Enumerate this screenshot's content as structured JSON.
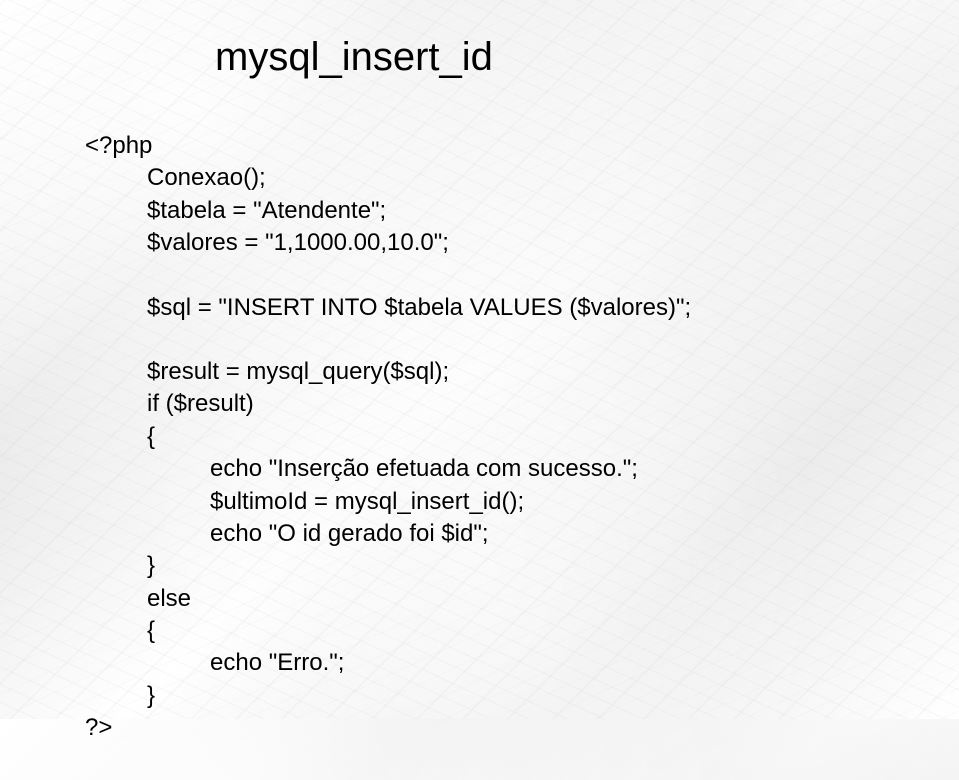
{
  "slide": {
    "title": "mysql_insert_id",
    "code": {
      "line1": "<?php",
      "line2": "Conexao();",
      "line3": "$tabela = \"Atendente\";",
      "line4": "$valores = \"1,1000.00,10.0\";",
      "line5": "$sql = \"INSERT INTO $tabela  VALUES ($valores)\";",
      "line6": "$result = mysql_query($sql);",
      "line7": "if ($result)",
      "line8": "{",
      "line9": "echo \"Inserção efetuada com sucesso.\";",
      "line10": "$ultimoId = mysql_insert_id();",
      "line11": "echo \"O id gerado foi $id\";",
      "line12": "}",
      "line13": "else",
      "line14": "{",
      "line15": "echo \"Erro.\";",
      "line16": "}",
      "line17": "?>"
    }
  }
}
